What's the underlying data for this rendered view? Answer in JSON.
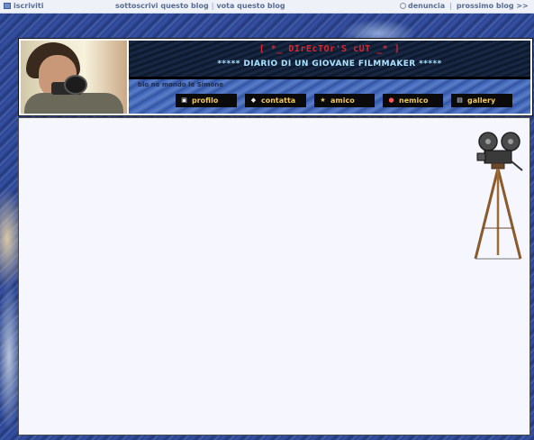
{
  "topbar": {
    "left_link": "iscriviti",
    "mid_link1": "sottoscrivi questo blog",
    "mid_sep": "|",
    "mid_link2": "vota questo blog",
    "right_link1": "denuncia",
    "right_sep": "|",
    "right_link2": "prossimo blog >>"
  },
  "header": {
    "title": "[ *_ DIrEcTOr'S cUT _* ]",
    "tagline": "***** DIARIO DI UN GIOVANE FILMMAKER *****",
    "subtitle": "blo  ne  mondo   le Simone",
    "nav": [
      {
        "label": "profilo",
        "icon": "profile-icon"
      },
      {
        "label": "contatta",
        "icon": "tag-icon"
      },
      {
        "label": "amico",
        "icon": "star-icon"
      },
      {
        "label": "nemico",
        "icon": "block-icon"
      },
      {
        "label": "gallery",
        "icon": "gallery-icon"
      }
    ]
  },
  "colors": {
    "title_red": "#e0242c",
    "tagline_blue": "#a9e3ff",
    "nav_text": "#f0c75a",
    "panel_bg": "#f6f6fe"
  }
}
